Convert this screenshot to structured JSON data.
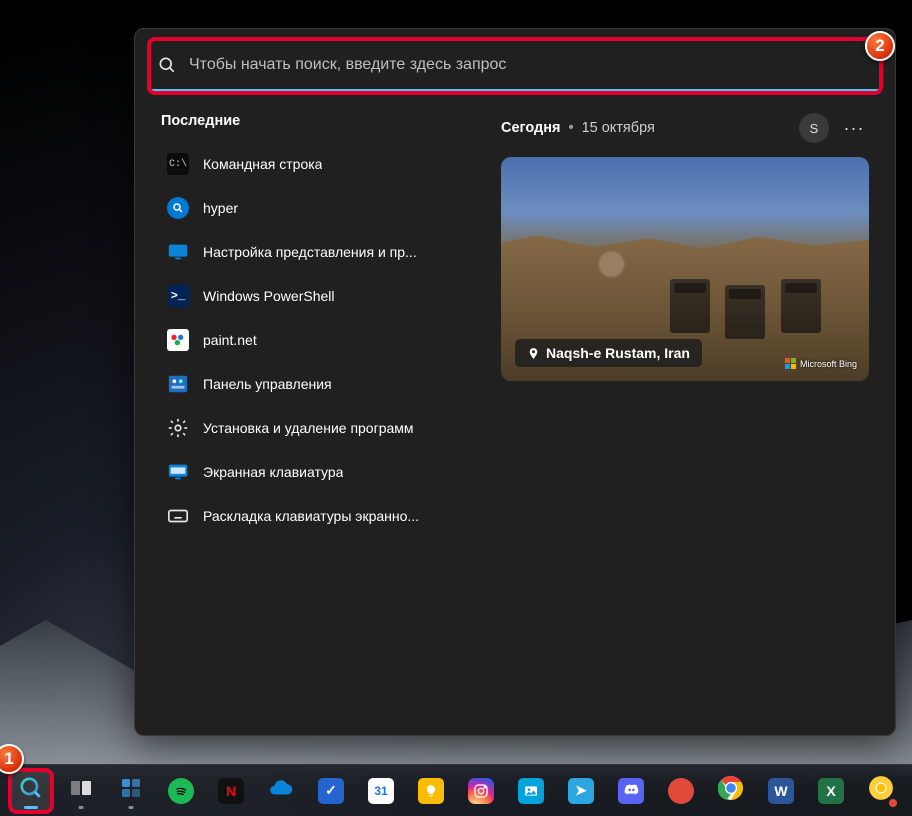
{
  "search": {
    "placeholder": "Чтобы начать поиск, введите здесь запрос"
  },
  "callouts": {
    "one": "1",
    "two": "2"
  },
  "recent": {
    "title": "Последние",
    "items": [
      {
        "label": "Командная строка",
        "icon": "cmd"
      },
      {
        "label": "hyper",
        "icon": "search"
      },
      {
        "label": "Настройка представления и пр...",
        "icon": "display-settings"
      },
      {
        "label": "Windows PowerShell",
        "icon": "powershell"
      },
      {
        "label": "paint.net",
        "icon": "paintnet"
      },
      {
        "label": "Панель управления",
        "icon": "control-panel"
      },
      {
        "label": "Установка и удаление программ",
        "icon": "apps-settings"
      },
      {
        "label": "Экранная клавиатура",
        "icon": "osk"
      },
      {
        "label": "Раскладка клавиатуры экранно...",
        "icon": "keyboard-layout"
      }
    ]
  },
  "today": {
    "label": "Сегодня",
    "date": "15 октября",
    "user_initial": "S",
    "more": "···",
    "image_caption": "Naqsh-e Rustam, Iran",
    "bing_logo": "Microsoft Bing"
  },
  "taskbar": {
    "items": [
      {
        "name": "start",
        "kind": "winlogo"
      },
      {
        "name": "search",
        "kind": "search",
        "active": true
      },
      {
        "name": "task-view",
        "kind": "taskview"
      },
      {
        "name": "widgets",
        "kind": "widgets"
      },
      {
        "name": "spotify",
        "kind": "tile",
        "bg": "#1db954",
        "glyph": ""
      },
      {
        "name": "netflix",
        "kind": "tile",
        "bg": "#111",
        "fg": "#e50914",
        "glyph": "N"
      },
      {
        "name": "onedrive",
        "kind": "cloud",
        "bg": "#0a84d8"
      },
      {
        "name": "todo",
        "kind": "tile",
        "bg": "#2564cf",
        "glyph": "✓"
      },
      {
        "name": "calendar",
        "kind": "tile",
        "bg": "#fff",
        "fg": "#1a73e8",
        "glyph": "31"
      },
      {
        "name": "keep",
        "kind": "tile",
        "bg": "#fbbc04",
        "fg": "#fff",
        "glyph": ""
      },
      {
        "name": "instagram",
        "kind": "instagram"
      },
      {
        "name": "photos",
        "kind": "tile",
        "bg": "#00a3da",
        "glyph": ""
      },
      {
        "name": "telegram",
        "kind": "tile",
        "bg": "#2ca5e0",
        "glyph": "➤"
      },
      {
        "name": "discord",
        "kind": "tile",
        "bg": "#5865f2",
        "glyph": ""
      },
      {
        "name": "app-red",
        "kind": "tile",
        "bg": "#e04a3a",
        "glyph": ""
      },
      {
        "name": "chrome",
        "kind": "chrome"
      },
      {
        "name": "word",
        "kind": "tile",
        "bg": "#2b579a",
        "glyph": "W"
      },
      {
        "name": "excel",
        "kind": "tile",
        "bg": "#217346",
        "glyph": "X"
      },
      {
        "name": "chrome-canary",
        "kind": "chrome-canary"
      },
      {
        "name": "sheets",
        "kind": "tile",
        "bg": "#0f9d58",
        "glyph": ""
      }
    ]
  }
}
